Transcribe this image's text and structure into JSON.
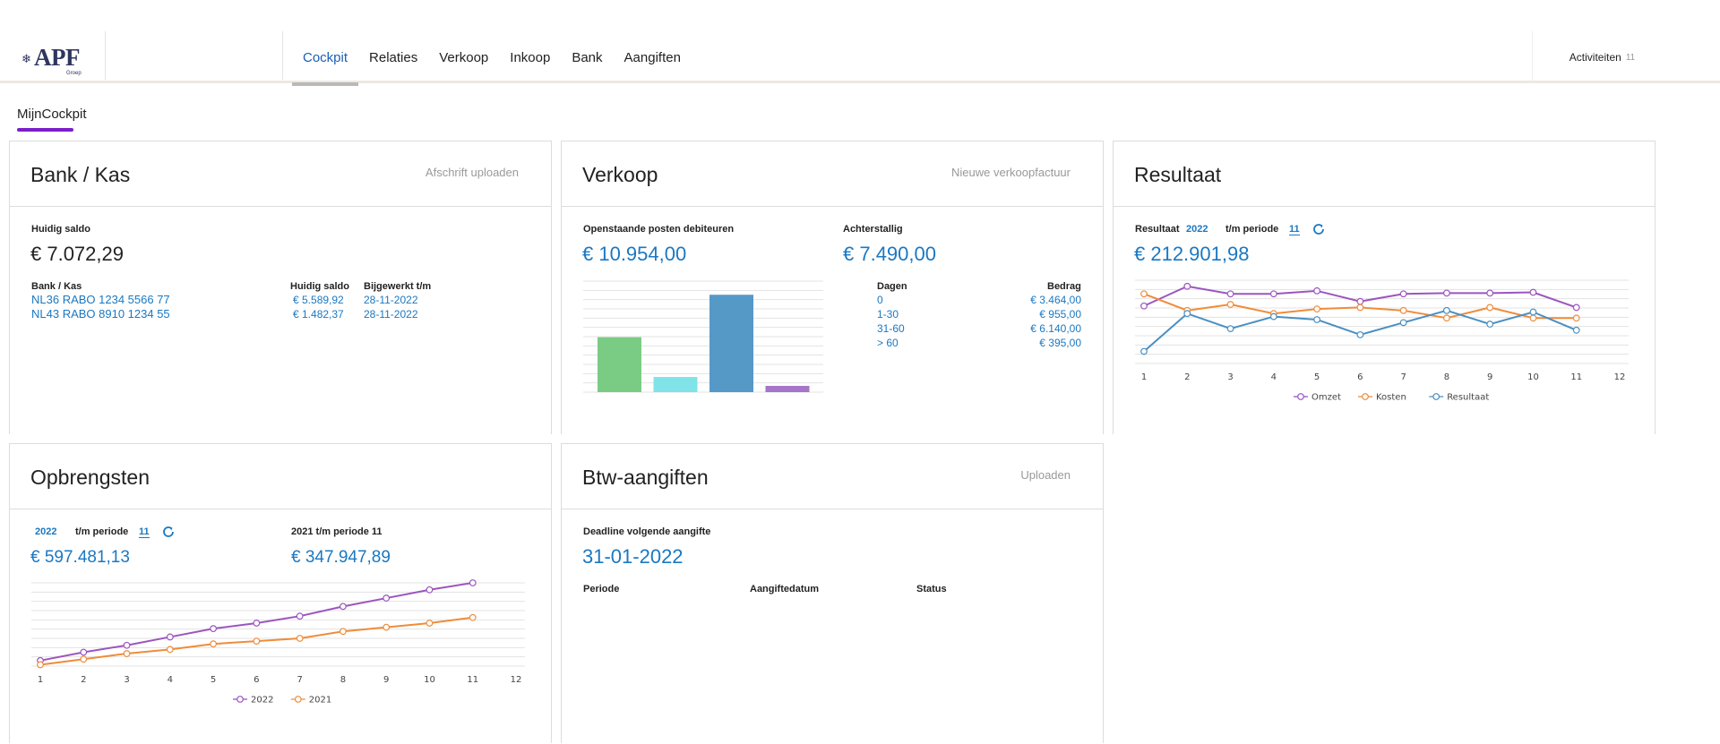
{
  "header": {
    "logo": "APF",
    "logo_sub": "Groep",
    "nav": [
      "Cockpit",
      "Relaties",
      "Verkoop",
      "Inkoop",
      "Bank",
      "Aangiften"
    ],
    "activities_label": "Activiteiten",
    "activities_count": "11"
  },
  "page_tab": "MijnCockpit",
  "bank": {
    "title": "Bank / Kas",
    "action": "Afschrift uploaden",
    "saldo_label": "Huidig saldo",
    "saldo": "€ 7.072,29",
    "col_account": "Bank / Kas",
    "col_saldo": "Huidig saldo",
    "col_updated": "Bijgewerkt t/m",
    "accounts": [
      {
        "name": "NL36 RABO 1234 5566 77",
        "saldo": "€ 5.589,92",
        "date": "28-11-2022"
      },
      {
        "name": "NL43 RABO 8910 1234 55",
        "saldo": "€ 1.482,37",
        "date": "28-11-2022"
      }
    ]
  },
  "verkoop": {
    "title": "Verkoop",
    "action": "Nieuwe verkoopfactuur",
    "open_label": "Openstaande posten debiteuren",
    "open_value": "€ 10.954,00",
    "overdue_label": "Achterstallig",
    "overdue_value": "€ 7.490,00",
    "col_days": "Dagen",
    "col_amount": "Bedrag",
    "rows": [
      {
        "days": "0",
        "amount": "€ 3.464,00"
      },
      {
        "days": "1-30",
        "amount": "€ 955,00"
      },
      {
        "days": "31-60",
        "amount": "€ 6.140,00"
      },
      {
        "days": "> 60",
        "amount": "€ 395,00"
      }
    ]
  },
  "resultaat": {
    "title": "Resultaat",
    "label": "Resultaat",
    "year": "2022",
    "period_label": "t/m periode",
    "period": "11",
    "value": "€ 212.901,98"
  },
  "opbrengsten": {
    "title": "Opbrengsten",
    "year": "2022",
    "period_label": "t/m periode",
    "period": "11",
    "value_current": "€ 597.481,13",
    "prev_label": "2021 t/m periode 11",
    "value_prev": "€ 347.947,89"
  },
  "btw": {
    "title": "Btw-aangiften",
    "action": "Uploaden",
    "deadline_label": "Deadline volgende aangifte",
    "deadline": "31-01-2022",
    "col_period": "Periode",
    "col_date": "Aangiftedatum",
    "col_status": "Status"
  },
  "chart_data": [
    {
      "type": "bar",
      "chart": "verkoop",
      "categories": [
        "0",
        "1-30",
        "31-60",
        "> 60"
      ],
      "values": [
        3464,
        955,
        6140,
        395
      ],
      "colors": [
        "#7acc84",
        "#7fe3e8",
        "#5599c7",
        "#a575c8"
      ],
      "ylim": [
        0,
        7000
      ]
    },
    {
      "type": "line",
      "chart": "resultaat",
      "x": [
        "1",
        "2",
        "3",
        "4",
        "5",
        "6",
        "7",
        "8",
        "9",
        "10",
        "11",
        "12"
      ],
      "series": [
        {
          "name": "Omzet",
          "color": "#9b55c0",
          "values": [
            58,
            71,
            66,
            66,
            68,
            61,
            66,
            66.5,
            66.5,
            67,
            57
          ]
        },
        {
          "name": "Kosten",
          "color": "#ef8c3a",
          "values": [
            66,
            55,
            59,
            53,
            56,
            57,
            55,
            50,
            57,
            50,
            50
          ]
        },
        {
          "name": "Resultaat",
          "color": "#4a8fc1",
          "values": [
            28,
            53,
            43,
            51,
            49,
            39,
            47,
            55,
            46,
            54,
            42
          ]
        }
      ],
      "ylim": [
        20,
        75
      ],
      "legend": "bottom"
    },
    {
      "type": "line",
      "chart": "opbrengsten",
      "x": [
        "1",
        "2",
        "3",
        "4",
        "5",
        "6",
        "7",
        "8",
        "9",
        "10",
        "11",
        "12"
      ],
      "series": [
        {
          "name": "2022",
          "color": "#9b55c0",
          "values": [
            4,
            10,
            15,
            21,
            27,
            31,
            36,
            43,
            49,
            55,
            60
          ]
        },
        {
          "name": "2021",
          "color": "#ef8c3a",
          "values": [
            1,
            5,
            9,
            12,
            16,
            18,
            20,
            25,
            28,
            31,
            35
          ]
        }
      ],
      "ylim": [
        0,
        60
      ],
      "legend": "bottom"
    }
  ]
}
